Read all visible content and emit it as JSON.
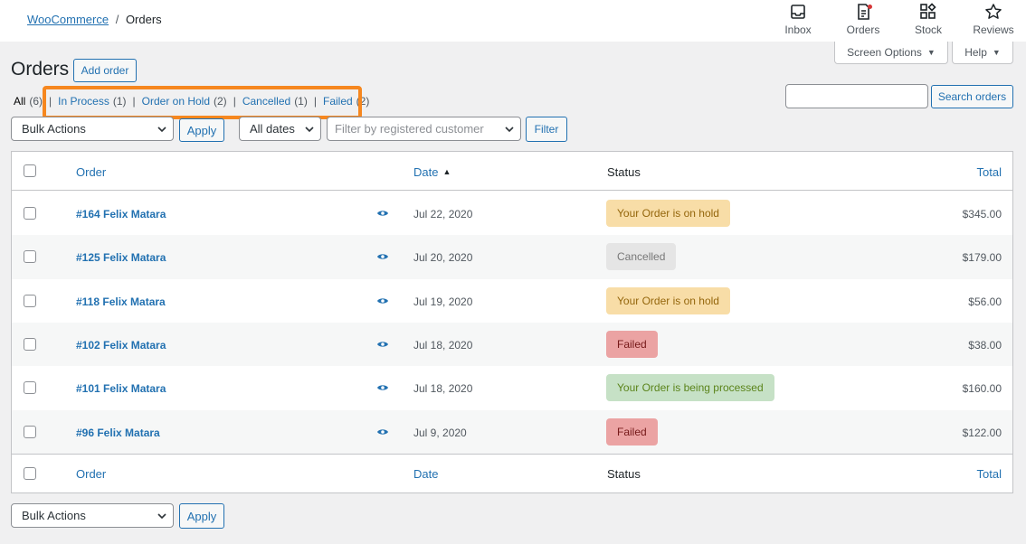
{
  "breadcrumb": {
    "parent": "WooCommerce",
    "separator": "/",
    "current": "Orders"
  },
  "top_nav": [
    {
      "label": "Inbox",
      "icon": "inbox-icon"
    },
    {
      "label": "Orders",
      "icon": "orders-icon"
    },
    {
      "label": "Stock",
      "icon": "stock-icon"
    },
    {
      "label": "Reviews",
      "icon": "star-icon"
    }
  ],
  "screen_options": {
    "label": "Screen Options",
    "help": "Help"
  },
  "page": {
    "title": "Orders",
    "add_button": "Add order"
  },
  "status_filters": [
    {
      "label": "All",
      "count": "(6)"
    },
    {
      "label": "In Process",
      "count": "(1)"
    },
    {
      "label": "Order on Hold",
      "count": "(2)"
    },
    {
      "label": "Cancelled",
      "count": "(1)"
    },
    {
      "label": "Failed",
      "count": "(2)"
    }
  ],
  "search": {
    "value": "",
    "button": "Search orders"
  },
  "toolbar": {
    "bulk_actions": "Bulk Actions",
    "apply": "Apply",
    "dates": "All dates",
    "customer_placeholder": "Filter by registered customer",
    "filter": "Filter"
  },
  "columns": {
    "order": "Order",
    "date": "Date",
    "status": "Status",
    "total": "Total"
  },
  "orders": [
    {
      "order": "#164 Felix Matara",
      "date": "Jul 22, 2020",
      "status": "Your Order is on hold",
      "status_type": "on-hold",
      "total": "$345.00"
    },
    {
      "order": "#125 Felix Matara",
      "date": "Jul 20, 2020",
      "status": "Cancelled",
      "status_type": "cancelled",
      "total": "$179.00"
    },
    {
      "order": "#118 Felix Matara",
      "date": "Jul 19, 2020",
      "status": "Your Order is on hold",
      "status_type": "on-hold",
      "total": "$56.00"
    },
    {
      "order": "#102 Felix Matara",
      "date": "Jul 18, 2020",
      "status": "Failed",
      "status_type": "failed",
      "total": "$38.00"
    },
    {
      "order": "#101 Felix Matara",
      "date": "Jul 18, 2020",
      "status": "Your Order is being processed",
      "status_type": "processing",
      "total": "$160.00"
    },
    {
      "order": "#96 Felix Matara",
      "date": "Jul 9, 2020",
      "status": "Failed",
      "status_type": "failed",
      "total": "$122.00"
    }
  ],
  "bottom_toolbar": {
    "bulk_actions": "Bulk Actions",
    "apply": "Apply"
  },
  "colors": {
    "accent": "#2271b1",
    "highlight": "#f6871f",
    "on_hold_bg": "#f8dda7",
    "on_hold_fg": "#94660c",
    "cancelled_bg": "#e5e5e5",
    "cancelled_fg": "#777777",
    "failed_bg": "#eba3a3",
    "failed_fg": "#761919",
    "processing_bg": "#c6e1c6",
    "processing_fg": "#5b841b"
  }
}
